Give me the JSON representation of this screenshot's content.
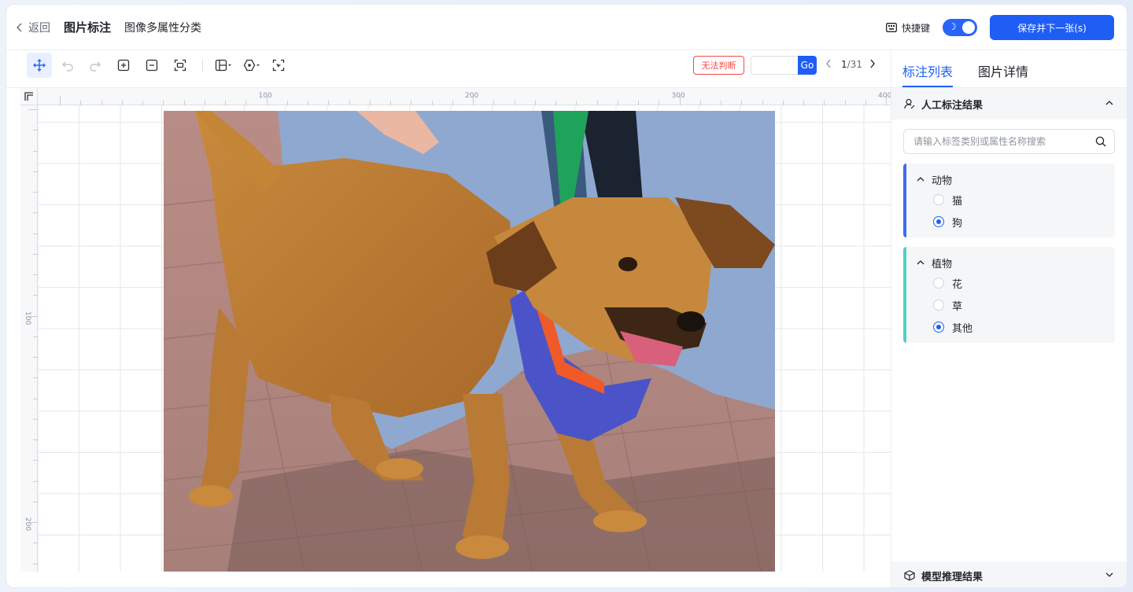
{
  "header": {
    "back_label": "返回",
    "title": "图片标注",
    "subtitle": "图像多属性分类",
    "shortcut_label": "快捷键",
    "dark_mode_on": true,
    "save_next_label": "保存并下一张(s)"
  },
  "toolbar": {
    "tools": [
      "move-icon",
      "undo-icon",
      "redo-icon",
      "zoom-in-icon",
      "zoom-out-icon",
      "fit-screen-icon",
      "layout-icon",
      "polygon-icon",
      "smart-select-icon"
    ],
    "cant_judge_label": "无法判断",
    "page_input_value": "",
    "go_label": "Go",
    "page_current": "1",
    "page_total": "/31"
  },
  "ruler": {
    "top_labels": [
      "100",
      "200",
      "300",
      "400"
    ],
    "left_labels": [
      "100",
      "200"
    ]
  },
  "side": {
    "tabs": [
      {
        "label": "标注列表",
        "active": true
      },
      {
        "label": "图片详情",
        "active": false
      }
    ],
    "manual_section_title": "人工标注结果",
    "search_placeholder": "请输入标签类别或属性名称搜索",
    "groups": [
      {
        "name": "动物",
        "color": "#3c6bf6",
        "options": [
          {
            "label": "猫",
            "selected": false
          },
          {
            "label": "狗",
            "selected": true
          }
        ]
      },
      {
        "name": "植物",
        "color": "#4fd1c5",
        "options": [
          {
            "label": "花",
            "selected": false
          },
          {
            "label": "草",
            "selected": false
          },
          {
            "label": "其他",
            "selected": true
          }
        ]
      }
    ],
    "model_section_title": "模型推理结果"
  },
  "colors": {
    "primary": "#1e5ef5",
    "danger": "#f54a45"
  }
}
